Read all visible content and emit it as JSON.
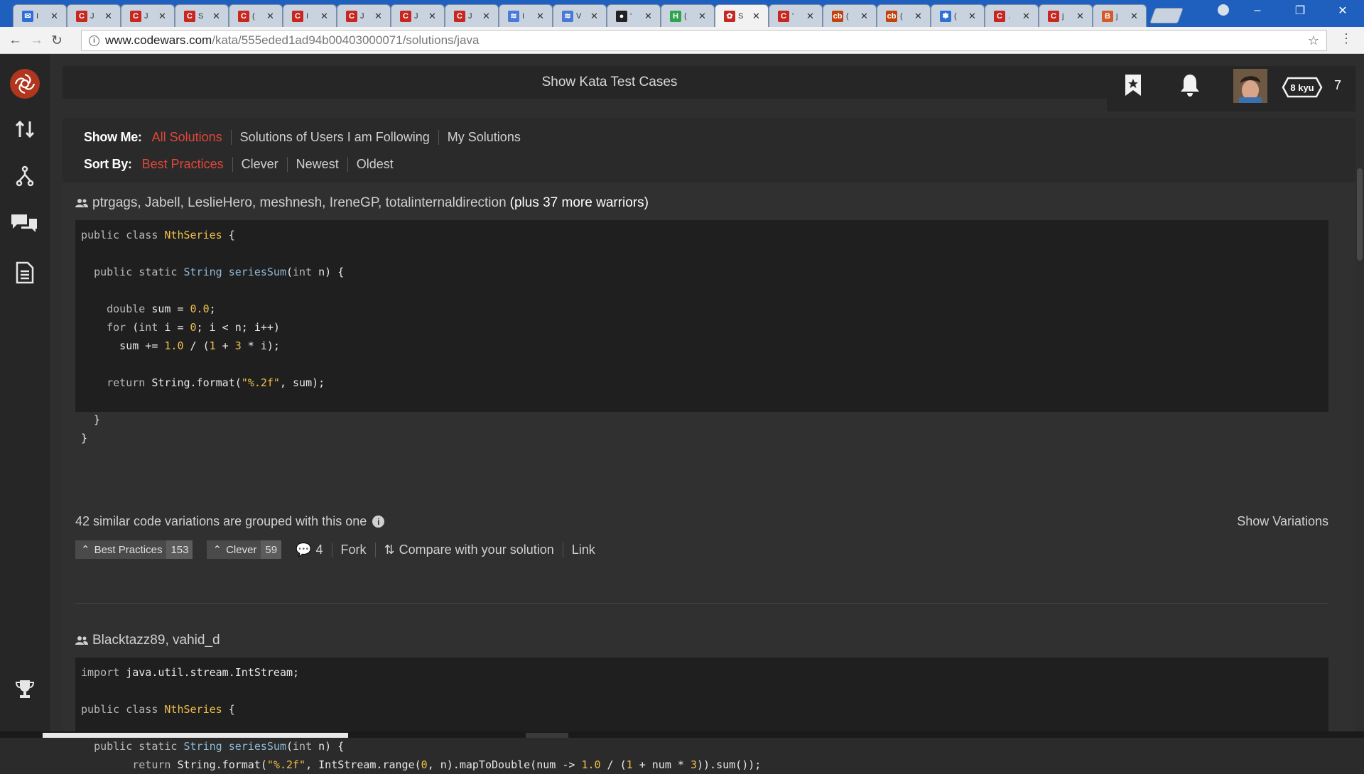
{
  "browser": {
    "tabs": [
      {
        "icon": "inbox-icon",
        "title": "I",
        "color": "#2d6fd6",
        "glyph": "✉"
      },
      {
        "icon": "codewars-icon",
        "title": "J",
        "color": "#c7271f",
        "glyph": "C"
      },
      {
        "icon": "codewars-icon",
        "title": "J",
        "color": "#c7271f",
        "glyph": "C"
      },
      {
        "icon": "codewars-icon",
        "title": "S",
        "color": "#c7271f",
        "glyph": "C"
      },
      {
        "icon": "codewars-icon",
        "title": "(",
        "color": "#c7271f",
        "glyph": "C"
      },
      {
        "icon": "codewars-icon",
        "title": "I",
        "color": "#c7271f",
        "glyph": "C"
      },
      {
        "icon": "codewars-icon",
        "title": "J",
        "color": "#c7271f",
        "glyph": "C"
      },
      {
        "icon": "codewars-icon",
        "title": "J",
        "color": "#c7271f",
        "glyph": "C"
      },
      {
        "icon": "codewars-icon",
        "title": "J",
        "color": "#c7271f",
        "glyph": "C"
      },
      {
        "icon": "layers-icon",
        "title": "I",
        "color": "#4a7ad6",
        "glyph": "≋"
      },
      {
        "icon": "layers-icon",
        "title": "V",
        "color": "#4a7ad6",
        "glyph": "≋"
      },
      {
        "icon": "github-icon",
        "title": "'",
        "color": "#222222",
        "glyph": "●"
      },
      {
        "icon": "h-icon",
        "title": "(",
        "color": "#2ea44f",
        "glyph": "H"
      },
      {
        "icon": "codewars-logo-icon",
        "title": "S",
        "color": "#c7271f",
        "glyph": "✿",
        "active": true
      },
      {
        "icon": "codewars-icon",
        "title": "'",
        "color": "#c7271f",
        "glyph": "C"
      },
      {
        "icon": "cb-icon",
        "title": "(",
        "color": "#c1440e",
        "glyph": "cb"
      },
      {
        "icon": "cb-icon",
        "title": "(",
        "color": "#c1440e",
        "glyph": "cb"
      },
      {
        "icon": "paw-icon",
        "title": "(",
        "color": "#2f6fd6",
        "glyph": "✽"
      },
      {
        "icon": "codewars-icon",
        "title": ".",
        "color": "#c7271f",
        "glyph": "C"
      },
      {
        "icon": "codewars-icon",
        "title": "j",
        "color": "#c7271f",
        "glyph": "C"
      },
      {
        "icon": "b-icon",
        "title": "j",
        "color": "#d35a2b",
        "glyph": "B"
      }
    ],
    "url_host": "www.codewars.com",
    "url_path": "/kata/555eded1ad94b00403000071/solutions/java"
  },
  "header": {
    "test_cases_label": "Show Kata Test Cases",
    "rank": "8 kyu",
    "honor": "7"
  },
  "filters": {
    "show_me_label": "Show Me:",
    "show_me_options": [
      "All Solutions",
      "Solutions of Users I am Following",
      "My Solutions"
    ],
    "show_me_selected": 0,
    "sort_by_label": "Sort By:",
    "sort_by_options": [
      "Best Practices",
      "Clever",
      "Newest",
      "Oldest"
    ],
    "sort_by_selected": 0
  },
  "solutions": [
    {
      "warriors": "ptrgags, Jabell, LeslieHero, meshnesh, IreneGP, totalinternaldirection",
      "more": "(plus 37 more warriors)",
      "variations_text": "42 similar code variations are grouped with this one",
      "show_variations": "Show Variations",
      "best_practices_label": "Best Practices",
      "best_practices_count": "153",
      "clever_label": "Clever",
      "clever_count": "59",
      "comments": "4",
      "fork": "Fork",
      "compare": "Compare with your solution",
      "link": "Link"
    },
    {
      "warriors": "Blacktazz89, vahid_d",
      "more": ""
    }
  ]
}
